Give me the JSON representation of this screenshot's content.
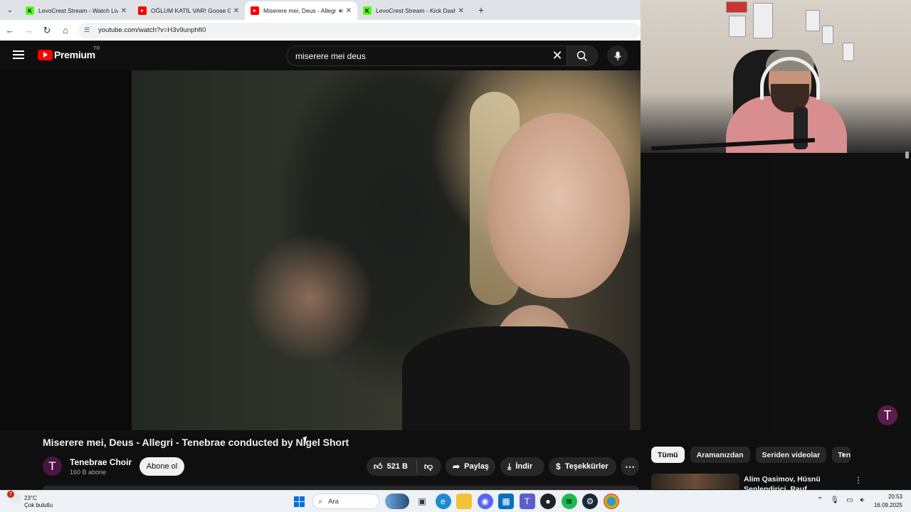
{
  "browser": {
    "tabs": [
      {
        "title": "LevoCrest Stream - Watch Live",
        "favicon": "kick-icon",
        "active": false
      },
      {
        "title": "OĞLUM KATİL VAR! Goose Goose",
        "favicon": "youtube-icon",
        "active": false
      },
      {
        "title": "Miserere mei, Deus - Allegri",
        "favicon": "youtube-icon",
        "active": true
      },
      {
        "title": "LevoCrest Stream - Kick Dashbo",
        "favicon": "kick-icon",
        "active": false
      }
    ],
    "url": "youtube.com/watch?v=H3v9unphfI0"
  },
  "youtube": {
    "logo_text": "Premium",
    "country_code": "TR",
    "search_value": "miserere mei deus"
  },
  "video": {
    "title": "Miserere mei, Deus - Allegri - Tenebrae conducted by Nigel Short",
    "channel_name": "Tenebrae Choir",
    "channel_initial": "T",
    "subscribers": "160 B abone",
    "subscribe_label": "Abone ol",
    "likes": "521 B",
    "share_label": "Paylaş",
    "download_label": "İndir",
    "thanks_label": "Teşekkürler",
    "watermark_initial": "T"
  },
  "chips": [
    "Tümü",
    "Aramanızdan",
    "Seriden videolar",
    "Ten"
  ],
  "recommendation": {
    "title": "Alim Qasimov, Hüsnü Şenlendirici, Rauf Islamov"
  },
  "taskbar": {
    "temperature": "23°C",
    "weather": "Çok bulutlu",
    "weather_badge": "7",
    "search_label": "Ara",
    "time": "20:53",
    "date": "16.09.2025"
  },
  "colors": {
    "youtube_red": "#ff0000",
    "kick_green": "#53fc18",
    "page_bg": "#0f0f0f"
  }
}
